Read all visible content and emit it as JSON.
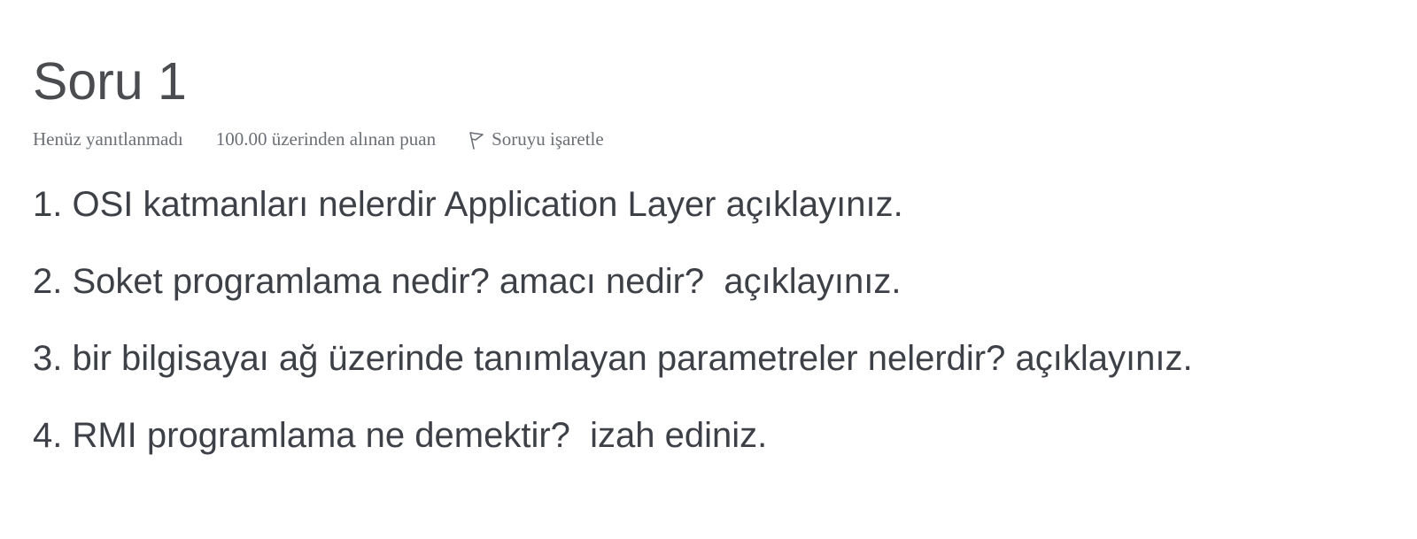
{
  "question": {
    "title": "Soru 1",
    "status": "Henüz yanıtlanmadı",
    "grade": "100.00 üzerinden alınan puan",
    "flag_label": "Soruyu işaretle",
    "flag_icon": "flag-icon",
    "lines": [
      "1. OSI katmanları nelerdir Application Layer açıklayınız.",
      "2. Soket programlama nedir? amacı nedir?  açıklayınız.",
      "3. bir bilgisayaı ağ üzerinde tanımlayan parametreler nelerdir? açıklayınız.",
      "4. RMI programlama ne demektir?  izah ediniz."
    ]
  }
}
